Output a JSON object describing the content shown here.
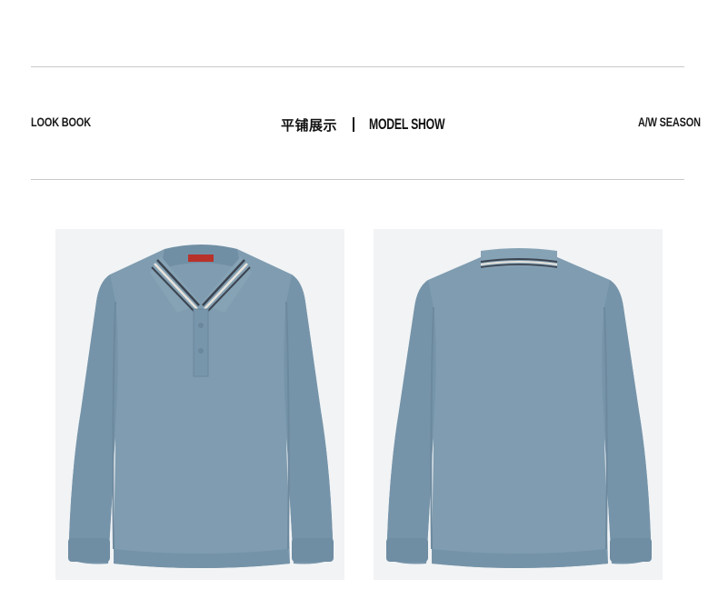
{
  "header": {
    "left_label": "LOOK BOOK",
    "center_cn": "平铺展示",
    "center_en": "MODEL SHOW",
    "right_label": "A/W SEASON"
  },
  "colors": {
    "shirt": "#7f9cb0",
    "shirt_shadow": "#6d8aa0",
    "panel_bg": "#f1f3f5",
    "rule": "#c9c9c9",
    "collar_stripe_dark": "#3b4450",
    "collar_stripe_light": "#e8e4dc",
    "label_red": "#b8322a"
  },
  "products": [
    {
      "view": "front",
      "icon": "polo-shirt-front-image"
    },
    {
      "view": "back",
      "icon": "polo-shirt-back-image"
    }
  ]
}
